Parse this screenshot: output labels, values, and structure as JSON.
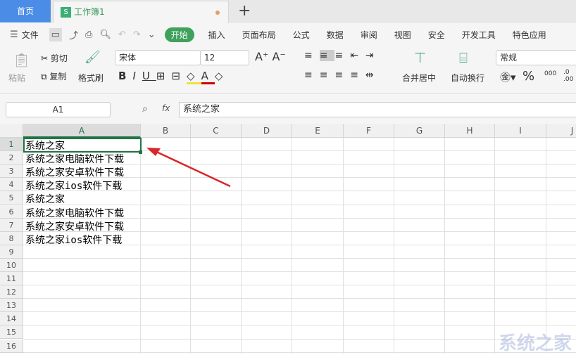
{
  "tabs": {
    "home": "首页",
    "workbook": "工作簿1",
    "workbook_icon": "S",
    "new_tab": "+"
  },
  "menu": {
    "file": "文件",
    "items": [
      "开始",
      "插入",
      "页面布局",
      "公式",
      "数据",
      "审阅",
      "视图",
      "安全",
      "开发工具",
      "特色应用"
    ]
  },
  "ribbon": {
    "paste": "粘贴",
    "cut": "剪切",
    "copy": "复制",
    "format_painter": "格式刷",
    "font": "宋体",
    "font_size": "12",
    "merge": "合并居中",
    "wrap": "自动换行",
    "number_format": "常规",
    "percent": "%",
    "thousands": "000",
    "decimals": ".0\n.00"
  },
  "formula_bar": {
    "name_box": "A1",
    "fx": "fx",
    "value": "系统之家"
  },
  "columns": [
    "A",
    "B",
    "C",
    "D",
    "E",
    "F",
    "G",
    "H",
    "I",
    "J"
  ],
  "rows": [
    "1",
    "2",
    "3",
    "4",
    "5",
    "6",
    "7",
    "8",
    "9",
    "10",
    "11",
    "12",
    "13",
    "14",
    "15",
    "16"
  ],
  "cells_a": [
    "系统之家",
    "系统之家电脑软件下载",
    "系统之家安卓软件下载",
    "系统之家ios软件下载",
    "系统之家",
    "系统之家电脑软件下载",
    "系统之家安卓软件下载",
    "系统之家ios软件下载"
  ],
  "watermark": "系统之家",
  "colors": {
    "accent": "#3fa15b",
    "home_tab": "#4b8de6",
    "selection": "#217346",
    "arrow": "#d9262a"
  }
}
